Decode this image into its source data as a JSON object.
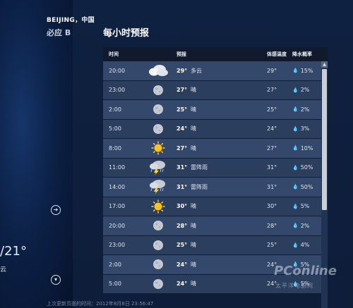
{
  "header": {
    "city": "BEIJING，中国",
    "bing_label": "必应 B",
    "section_title": "每小时预报"
  },
  "left": {
    "current_temp": "/21°",
    "condition": "云"
  },
  "table": {
    "columns": [
      "时间",
      "预报",
      "体感温度",
      "降水概率"
    ],
    "rows": [
      {
        "time": "20:00",
        "icon": "partly-cloudy-icon",
        "temp": "29°",
        "cond": "多云",
        "feel": "29°",
        "rain": "15%"
      },
      {
        "time": "23:00",
        "icon": "moon-icon",
        "temp": "27°",
        "cond": "晴",
        "feel": "27°",
        "rain": "2%"
      },
      {
        "time": "2:00",
        "icon": "moon-icon",
        "temp": "25°",
        "cond": "晴",
        "feel": "25°",
        "rain": "2%"
      },
      {
        "time": "5:00",
        "icon": "moon-icon",
        "temp": "24°",
        "cond": "晴",
        "feel": "24°",
        "rain": "3%"
      },
      {
        "time": "8:00",
        "icon": "sun-icon",
        "temp": "27°",
        "cond": "晴",
        "feel": "27°",
        "rain": "10%"
      },
      {
        "time": "11:00",
        "icon": "thunderstorm-icon",
        "temp": "31°",
        "cond": "雷阵雨",
        "feel": "31°",
        "rain": "50%"
      },
      {
        "time": "14:00",
        "icon": "thunderstorm-icon",
        "temp": "31°",
        "cond": "雷阵雨",
        "feel": "31°",
        "rain": "50%"
      },
      {
        "time": "17:00",
        "icon": "sun-icon",
        "temp": "30°",
        "cond": "晴",
        "feel": "30°",
        "rain": "5%"
      },
      {
        "time": "20:00",
        "icon": "moon-icon",
        "temp": "28°",
        "cond": "晴",
        "feel": "28°",
        "rain": "2%"
      },
      {
        "time": "23:00",
        "icon": "moon-icon",
        "temp": "25°",
        "cond": "晴",
        "feel": "25°",
        "rain": "4%"
      },
      {
        "time": "2:00",
        "icon": "moon-icon",
        "temp": "24°",
        "cond": "晴",
        "feel": "24°",
        "rain": "5%"
      },
      {
        "time": "5:00",
        "icon": "moon-icon",
        "temp": "24°",
        "cond": "晴",
        "feel": "24°",
        "rain": "5%"
      }
    ]
  },
  "footer": {
    "last_updated": "上次更新页面的时间：2012年8月8日 23:56:47"
  },
  "watermark": {
    "brand": "PConline",
    "sub": "太平洋电脑网"
  },
  "colors": {
    "row_odd": "#33486a",
    "row_even": "#2b3e5e",
    "header_bg": "#101a2c",
    "background": "#0c1a36"
  }
}
